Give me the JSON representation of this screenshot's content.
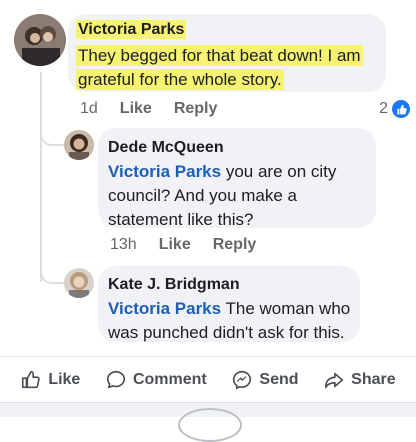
{
  "comments": [
    {
      "author": "Victoria Parks",
      "text": "They begged for that beat down! I am grateful for the whole story.",
      "time": "1d",
      "like_label": "Like",
      "reply_label": "Reply",
      "reaction_count": "2",
      "highlight_color": "#f6f372"
    }
  ],
  "replies": [
    {
      "author": "Dede McQueen",
      "mention": "Victoria Parks",
      "text": " you are on city council? And you make a statement like this?",
      "time": "13h",
      "like_label": "Like",
      "reply_label": "Reply"
    },
    {
      "author": "Kate J. Bridgman",
      "mention": "Victoria Parks",
      "text": " The woman who was punched didn't ask for this."
    }
  ],
  "actions": {
    "like": "Like",
    "comment": "Comment",
    "send": "Send",
    "share": "Share"
  },
  "icons": {
    "like": "thumbs-up-icon",
    "comment": "speech-bubble-icon",
    "send": "messenger-icon",
    "share": "share-arrow-icon",
    "reaction": "like-reaction-icon"
  },
  "colors": {
    "mention": "#1d5fb3",
    "reaction_badge": "#1877f2",
    "bubble": "#f0f2f5"
  }
}
